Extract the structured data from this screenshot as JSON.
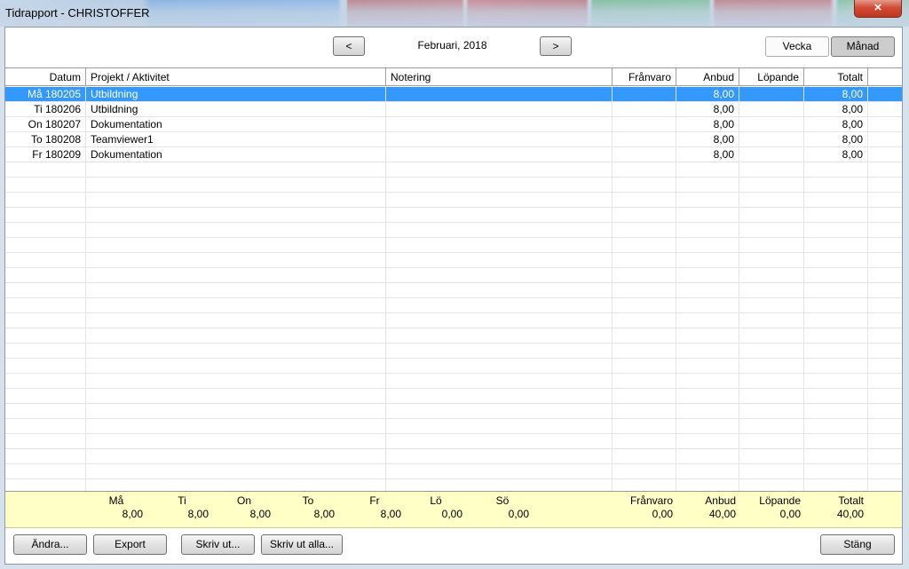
{
  "window": {
    "title": "Tidrapport - CHRISTOFFER",
    "close_glyph": "×"
  },
  "nav": {
    "prev_label": "<",
    "next_label": ">",
    "month_label": "Februari, 2018",
    "vecka_label": "Vecka",
    "manad_label": "Månad"
  },
  "columns": {
    "datum": "Datum",
    "projekt": "Projekt / Aktivitet",
    "notering": "Notering",
    "franvaro": "Frånvaro",
    "anbud": "Anbud",
    "lopande": "Löpande",
    "totalt": "Totalt"
  },
  "rows": [
    {
      "datum": "Må 180205",
      "projekt": "Utbildning",
      "notering": "",
      "franvaro": "",
      "anbud": "8,00",
      "lopande": "",
      "totalt": "8,00",
      "selected": true
    },
    {
      "datum": "Ti 180206",
      "projekt": "Utbildning",
      "notering": "",
      "franvaro": "",
      "anbud": "8,00",
      "lopande": "",
      "totalt": "8,00"
    },
    {
      "datum": "On 180207",
      "projekt": "Dokumentation",
      "notering": "",
      "franvaro": "",
      "anbud": "8,00",
      "lopande": "",
      "totalt": "8,00"
    },
    {
      "datum": "To 180208",
      "projekt": "Teamviewer1",
      "notering": "",
      "franvaro": "",
      "anbud": "8,00",
      "lopande": "",
      "totalt": "8,00"
    },
    {
      "datum": "Fr 180209",
      "projekt": "Dokumentation",
      "notering": "",
      "franvaro": "",
      "anbud": "8,00",
      "lopande": "",
      "totalt": "8,00"
    }
  ],
  "summary": {
    "days": [
      {
        "label": "Må",
        "value": "8,00"
      },
      {
        "label": "Ti",
        "value": "8,00"
      },
      {
        "label": "On",
        "value": "8,00"
      },
      {
        "label": "To",
        "value": "8,00"
      },
      {
        "label": "Fr",
        "value": "8,00"
      },
      {
        "label": "Lö",
        "value": "0,00"
      },
      {
        "label": "Sö",
        "value": "0,00"
      }
    ],
    "franvaro_label": "Frånvaro",
    "franvaro_value": "0,00",
    "anbud_label": "Anbud",
    "anbud_value": "40,00",
    "lopande_label": "Löpande",
    "lopande_value": "0,00",
    "totalt_label": "Totalt",
    "totalt_value": "40,00"
  },
  "buttons": {
    "andra": "Ändra...",
    "export": "Export",
    "skriv_ut": "Skriv ut...",
    "skriv_ut_alla": "Skriv ut alla...",
    "stang": "Stäng"
  },
  "colors": {
    "selection": "#3399ff",
    "summary_bg": "#ffffc6"
  }
}
